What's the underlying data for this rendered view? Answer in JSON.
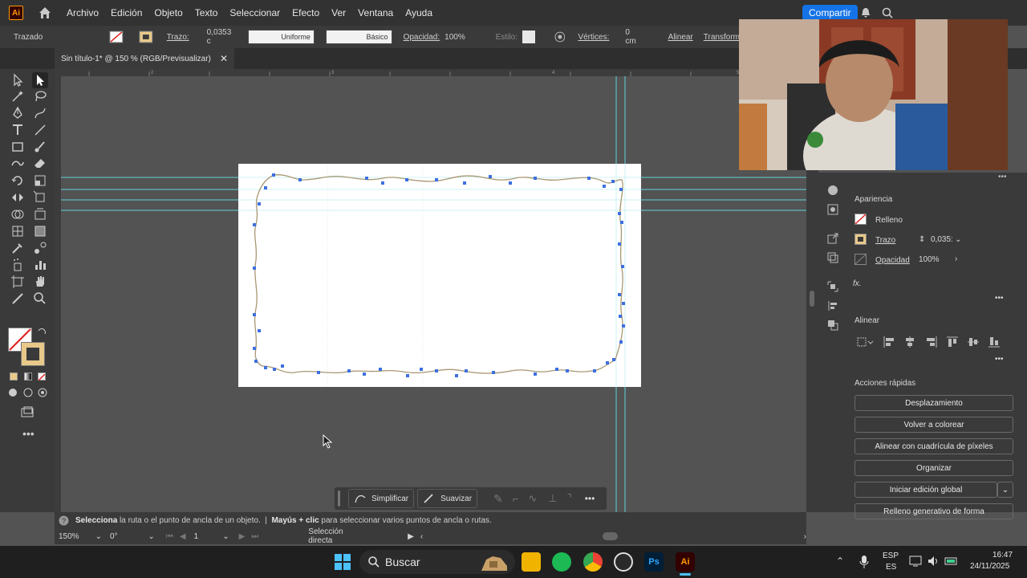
{
  "app": {
    "logo": "Ai"
  },
  "menu": [
    "Archivo",
    "Edición",
    "Objeto",
    "Texto",
    "Seleccionar",
    "Efecto",
    "Ver",
    "Ventana",
    "Ayuda"
  ],
  "share_label": "Compartir",
  "control": {
    "path_label": "Trazado",
    "stroke_label": "Trazo:",
    "stroke_value": "0,0353 c",
    "profile_label": "Uniforme",
    "brush_label": "Básico",
    "opacity_label": "Opacidad:",
    "opacity_value": "100%",
    "style_label": "Estilo:",
    "vertices_label": "Vértices:",
    "vertices_value": "0 cm",
    "align_label": "Alinear",
    "transform_label": "Transform"
  },
  "document_tab": {
    "title": "Sin título-1* @ 150 % (RGB/Previsualizar)"
  },
  "ruler_ticks": [
    "2",
    "3",
    "4",
    "5",
    "6",
    "7",
    "8"
  ],
  "appearance": {
    "title": "Apariencia",
    "fill_label": "Relleno",
    "stroke_label": "Trazo",
    "stroke_value": "0,035:",
    "opacity_label": "Opacidad",
    "opacity_value": "100%",
    "fx_label": "fx."
  },
  "align_panel": {
    "title": "Alinear"
  },
  "quick_actions": {
    "title": "Acciones rápidas",
    "buttons": [
      "Desplazamiento",
      "Volver a colorear",
      "Alinear con cuadrícula de píxeles",
      "Organizar",
      "Iniciar edición global",
      "Relleno generativo de forma"
    ]
  },
  "context_bar": {
    "simplify": "Simplificar",
    "smooth": "Suavizar"
  },
  "status": {
    "hint_bold1": "Selecciona",
    "hint1": " la ruta o el punto de ancla de un objeto.  |  ",
    "hint_bold2": "Mayús + clic",
    "hint2": " para seleccionar varios puntos de ancla o rutas."
  },
  "bottom": {
    "zoom": "150%",
    "rotation": "0°",
    "artboard_num": "1",
    "tool_name": "Selección directa"
  },
  "taskbar": {
    "search_placeholder": "Buscar",
    "lang1": "ESP",
    "lang2": "ES",
    "time": "16:47",
    "date": "24/11/2025"
  },
  "colors": {
    "accent": "#1473e6",
    "guide": "#5fd3d9",
    "anchor": "#3d6fe0",
    "path": "#a89772"
  }
}
